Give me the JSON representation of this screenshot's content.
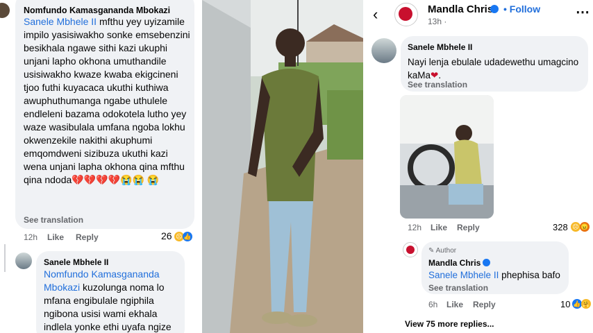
{
  "left": {
    "comment1": {
      "author": "Nomfundo Kamasgananda Mbokazi",
      "mention": "Sanele Mbhele II",
      "text": "mfthu yey uyizamile impilo yasisiwakho sonke emsebenzini besikhala ngawe sithi kazi ukuphi unjani lapho okhona umuthandile usisiwakho kwaze kwaba ekigcineni tjoo futhi kuyacaca ukuthi kuthiwa awuphuthumanga ngabe uthulele endleleni bazama odokotela lutho yey waze wasibulala umfana ngoba lokhu okwenzekile nakithi akuphumi emqomdweni sizibuza ukuthi kazi wena unjani lapha okhona qina mfthu qina ndoda",
      "emoji_tail": "💔💔💔💔😭😭",
      "emoji_last": "😭",
      "see_translation": "See translation",
      "time": "12h",
      "like": "Like",
      "reply": "Reply",
      "reaction_count": "26"
    },
    "comment2": {
      "author": "Sanele Mbhele II",
      "mention": "Nomfundo Kamasgananda Mbokazi",
      "text": "kuzolunga noma lo mfana engibulale ngiphila ngibona usisi wami ekhala indlela yonke ethi uyafa ngize"
    }
  },
  "right": {
    "header": {
      "back_icon": "back-arrow-icon",
      "page_name": "Mandla Chris",
      "verified_icon": "verified-badge-icon",
      "follow_label": "• Follow",
      "time": "13h ·",
      "more_icon": "more-icon"
    },
    "comment1": {
      "author": "Sanele Mbhele II",
      "text": "Nayi lenja ebulale udadewethu umagcino kaMa",
      "see_translation": "See translation",
      "time": "12h",
      "like": "Like",
      "reply": "Reply",
      "reaction_count": "328"
    },
    "reply1": {
      "badge": "Author",
      "author": "Mandla Chris",
      "mention": "Sanele Mbhele II",
      "text": " phephisa bafo",
      "see_translation": "See translation",
      "time": "6h",
      "like": "Like",
      "reply": "Reply",
      "reaction_count": "10"
    },
    "view_more": "View 75 more replies..."
  },
  "colors": {
    "link": "#216fdb",
    "bubble": "#f0f2f5",
    "muted": "#65676b"
  }
}
